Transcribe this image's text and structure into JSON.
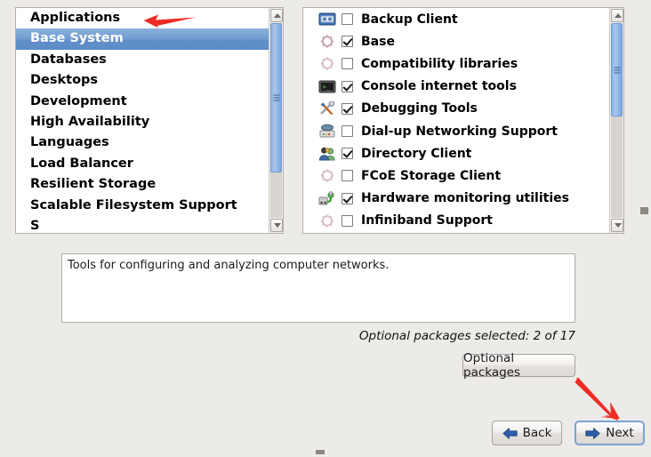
{
  "categories": {
    "items": [
      {
        "label": "Applications",
        "selected": false
      },
      {
        "label": "Base System",
        "selected": true
      },
      {
        "label": "Databases",
        "selected": false
      },
      {
        "label": "Desktops",
        "selected": false
      },
      {
        "label": "Development",
        "selected": false
      },
      {
        "label": "High Availability",
        "selected": false
      },
      {
        "label": "Languages",
        "selected": false
      },
      {
        "label": "Load Balancer",
        "selected": false
      },
      {
        "label": "Resilient Storage",
        "selected": false
      },
      {
        "label": "Scalable Filesystem Support",
        "selected": false
      },
      {
        "label": "S",
        "selected": false
      }
    ]
  },
  "packages": {
    "items": [
      {
        "label": "Backup Client",
        "checked": false,
        "icon": "tape-backup-icon"
      },
      {
        "label": "Base",
        "checked": true,
        "icon": "gear-package-icon"
      },
      {
        "label": "Compatibility libraries",
        "checked": false,
        "icon": "gear-package-icon"
      },
      {
        "label": "Console internet tools",
        "checked": true,
        "icon": "terminal-icon"
      },
      {
        "label": "Debugging Tools",
        "checked": true,
        "icon": "tools-icon"
      },
      {
        "label": "Dial-up Networking Support",
        "checked": false,
        "icon": "modem-icon"
      },
      {
        "label": "Directory Client",
        "checked": true,
        "icon": "users-icon"
      },
      {
        "label": "FCoE Storage Client",
        "checked": false,
        "icon": "gear-package-icon"
      },
      {
        "label": "Hardware monitoring utilities",
        "checked": true,
        "icon": "hardware-monitor-icon"
      },
      {
        "label": "Infiniband Support",
        "checked": false,
        "icon": "gear-package-icon"
      }
    ]
  },
  "description": {
    "text": "Tools for configuring and analyzing computer networks."
  },
  "status": {
    "optional_selected": "Optional packages selected: 2 of 17"
  },
  "buttons": {
    "optional_packages": "Optional packages",
    "back": "Back",
    "next": "Next"
  },
  "colors": {
    "selection_blue": "#6e9ad0",
    "scrollbar_thumb": "#8cb3e2",
    "annotation_red": "#ee2b24",
    "button_arrow_blue": "#2c5fa8",
    "window_bg": "#edebe8"
  }
}
